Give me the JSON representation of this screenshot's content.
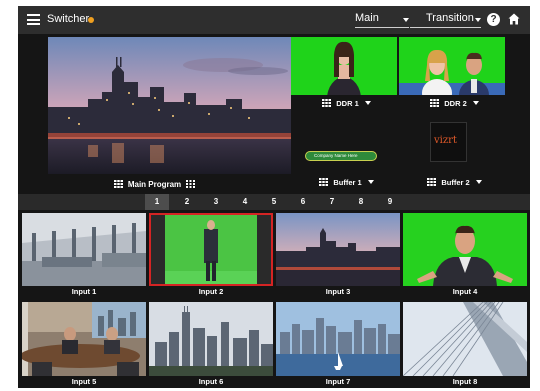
{
  "topbar": {
    "title": "Switcher",
    "status_color": "#f0a020",
    "layout_select": "Main",
    "transition_select": "Transition",
    "help_glyph": "?",
    "menu_icon": "hamburger-icon",
    "help_icon": "question-circle-icon",
    "home_icon": "home-icon"
  },
  "program": {
    "label": "Main Program"
  },
  "sources": {
    "ddr1": "DDR 1",
    "ddr2": "DDR 2",
    "buffer1": "Buffer 1",
    "buffer2": "Buffer 2",
    "buffer1_graphic": "Company Name Here",
    "buffer2_logo": "vizrt"
  },
  "pages": {
    "items": [
      "1",
      "2",
      "3",
      "4",
      "5",
      "6",
      "7",
      "8",
      "9"
    ],
    "active": "1"
  },
  "inputs": [
    {
      "label": "Input 1"
    },
    {
      "label": "Input 2",
      "selected": true
    },
    {
      "label": "Input 3"
    },
    {
      "label": "Input 4"
    },
    {
      "label": "Input 5"
    },
    {
      "label": "Input 6"
    },
    {
      "label": "Input 7"
    },
    {
      "label": "Input 8"
    }
  ],
  "colors": {
    "background": "#151515",
    "topbar": "#2e2e2e",
    "chroma_green": "#1fd31a",
    "selected_outline": "#d42424"
  }
}
